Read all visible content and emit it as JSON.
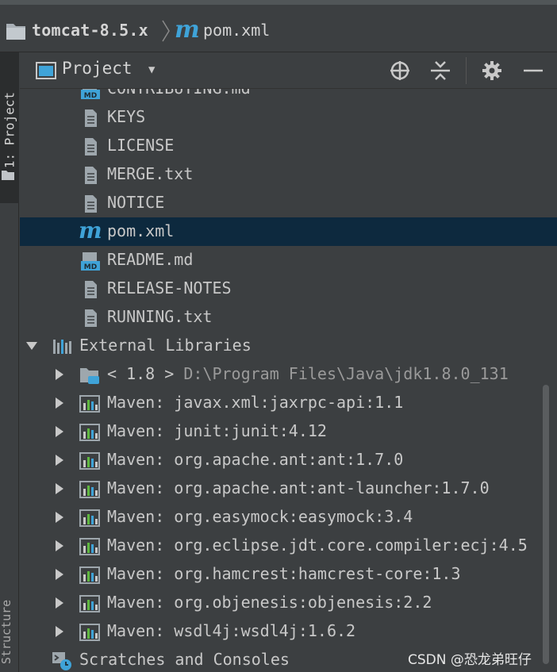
{
  "breadcrumb": {
    "project": "tomcat-8.5.x",
    "file_icon_letter": "m",
    "file": "pom.xml"
  },
  "left_stripe": {
    "project_tab": "1: Project",
    "structure_tab": "Z: Structure"
  },
  "tool_window": {
    "title": "Project",
    "buttons": [
      "locate-icon",
      "collapse-all-icon",
      "gear-icon",
      "hide-icon"
    ]
  },
  "tree": {
    "files": [
      {
        "name": "CONTRIBUTING.md",
        "icon": "markdown-file-icon"
      },
      {
        "name": "KEYS",
        "icon": "text-file-icon"
      },
      {
        "name": "LICENSE",
        "icon": "text-file-icon"
      },
      {
        "name": "MERGE.txt",
        "icon": "text-file-icon"
      },
      {
        "name": "NOTICE",
        "icon": "text-file-icon"
      },
      {
        "name": "pom.xml",
        "icon": "maven-file-icon",
        "selected": true
      },
      {
        "name": "README.md",
        "icon": "markdown-file-icon"
      },
      {
        "name": "RELEASE-NOTES",
        "icon": "text-file-icon"
      },
      {
        "name": "RUNNING.txt",
        "icon": "text-file-icon"
      }
    ],
    "external_libraries": {
      "label": "External Libraries",
      "expanded": true,
      "jdk": {
        "label": "< 1.8 >",
        "path": "D:\\Program Files\\Java\\jdk1.8.0_131"
      },
      "libraries": [
        "Maven: javax.xml:jaxrpc-api:1.1",
        "Maven: junit:junit:4.12",
        "Maven: org.apache.ant:ant:1.7.0",
        "Maven: org.apache.ant:ant-launcher:1.7.0",
        "Maven: org.easymock:easymock:3.4",
        "Maven: org.eclipse.jdt.core.compiler:ecj:4.5",
        "Maven: org.hamcrest:hamcrest-core:1.3",
        "Maven: org.objenesis:objenesis:2.2",
        "Maven: wsdl4j:wsdl4j:1.6.2"
      ]
    },
    "scratches": "Scratches and Consoles"
  },
  "watermark": "CSDN @恐龙弟旺仔",
  "colors": {
    "background": "#3c3f41",
    "selection": "#0d293e",
    "maven_blue": "#3fa3d8",
    "text": "#c8c8c8"
  }
}
